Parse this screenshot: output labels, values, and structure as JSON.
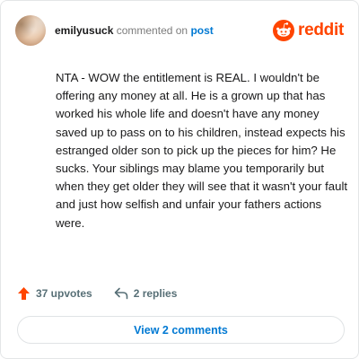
{
  "header": {
    "username": "emilyusuck",
    "commented_on": "commented on",
    "post_link": "post",
    "brand": "reddit"
  },
  "comment": {
    "text": "NTA - WOW the entitlement is REAL. I wouldn't be offering any money at all. He is a grown up that has worked his whole life and doesn't have any money saved up to pass on to his children, instead expects his estranged older son to pick up the pieces for him? He sucks. Your siblings may blame you temporarily but when they get older they will see that it wasn't your fault and just how selfish and unfair your fathers actions were."
  },
  "actions": {
    "upvotes": "37 upvotes",
    "replies": "2 replies"
  },
  "footer": {
    "view_comments": "View 2 comments"
  },
  "colors": {
    "brand": "#ff4500",
    "link": "#0079d3",
    "muted": "#7c7c7c"
  },
  "icons": {
    "avatar": "avatar",
    "logo": "reddit-logo-icon",
    "upvote": "upvote-arrow-icon",
    "reply": "reply-arrow-icon"
  }
}
